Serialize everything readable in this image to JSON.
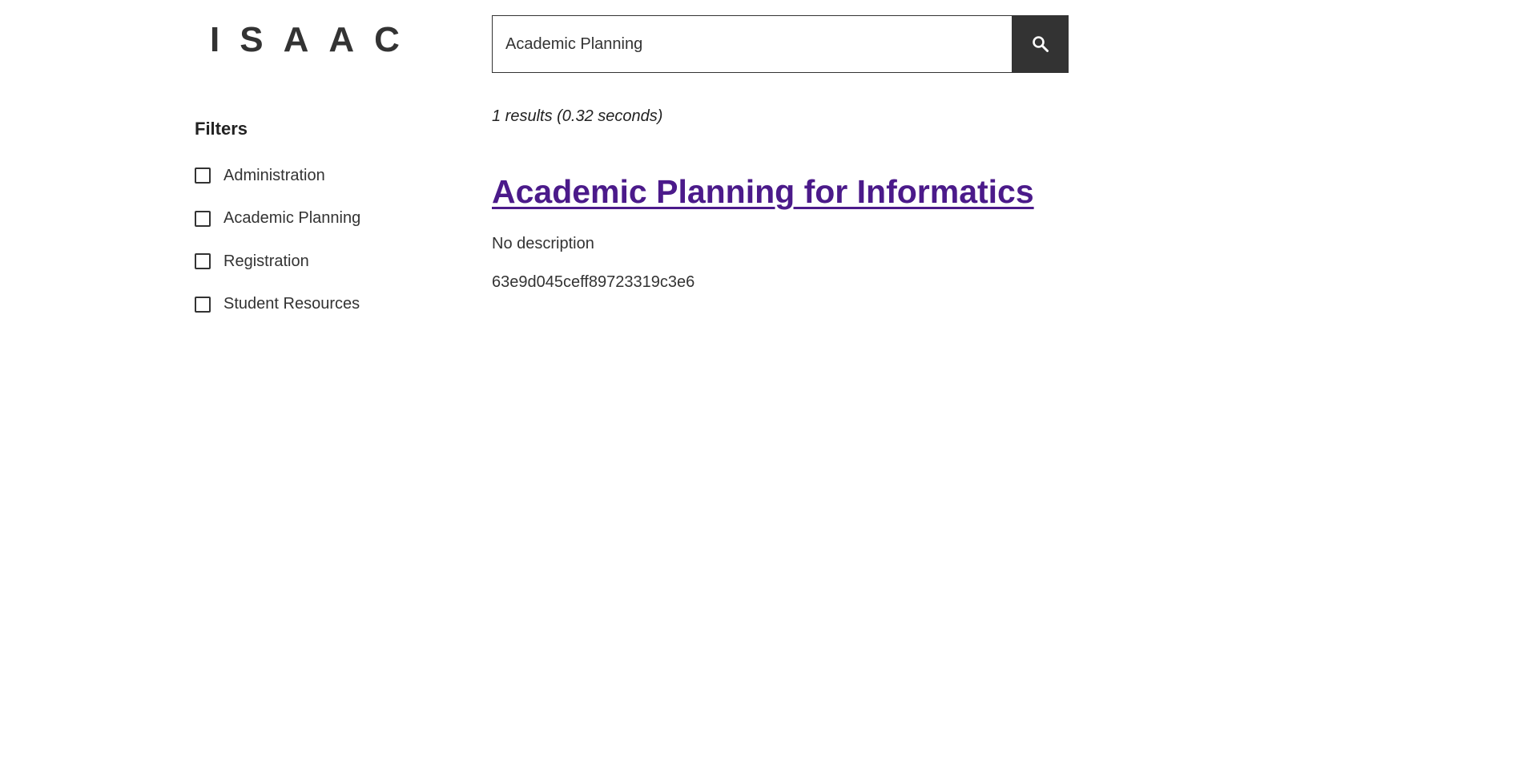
{
  "header": {
    "logo_text": "ISAAC"
  },
  "search": {
    "value": "Academic Planning",
    "button_icon": "search-icon"
  },
  "filters": {
    "title": "Filters",
    "items": [
      {
        "label": "Administration",
        "checked": false
      },
      {
        "label": "Academic Planning",
        "checked": false
      },
      {
        "label": "Registration",
        "checked": false
      },
      {
        "label": "Student Resources",
        "checked": false
      }
    ]
  },
  "results": {
    "summary": "1 results (0.32 seconds)",
    "items": [
      {
        "title": "Academic Planning for Informatics",
        "description": "No description",
        "id": "63e9d045ceff89723319c3e6"
      }
    ]
  },
  "colors": {
    "link": "#4b1a8a",
    "button_bg": "#333333",
    "text": "#333333"
  }
}
